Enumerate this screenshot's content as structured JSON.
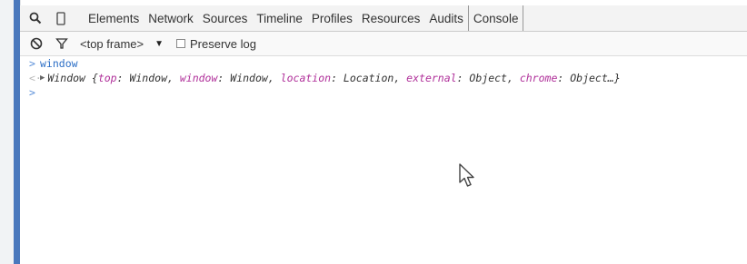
{
  "toolbar": {
    "tabs": [
      {
        "label": "Elements"
      },
      {
        "label": "Network"
      },
      {
        "label": "Sources"
      },
      {
        "label": "Timeline"
      },
      {
        "label": "Profiles"
      },
      {
        "label": "Resources"
      },
      {
        "label": "Audits"
      },
      {
        "label": "Console"
      }
    ],
    "active_tab": "Console",
    "icons": [
      "search-icon",
      "device-icon"
    ]
  },
  "console_toolbar": {
    "icons": [
      "clear-icon",
      "filter-icon"
    ],
    "frame_select": "<top frame>",
    "preserve_log_label": "Preserve log",
    "preserve_log_checked": false
  },
  "console": {
    "input_line": "window",
    "result": {
      "prefix": "Window {",
      "entries": [
        {
          "key": "top",
          "value": "Window"
        },
        {
          "key": "window",
          "value": "Window"
        },
        {
          "key": "location",
          "value": "Location"
        },
        {
          "key": "external",
          "value": "Object"
        },
        {
          "key": "chrome",
          "value": "Object…"
        }
      ],
      "suffix": "}"
    }
  },
  "colors": {
    "accent_bar": "#4a78bd",
    "prompt": "#5a8fd8",
    "property_key": "#b0309a"
  }
}
